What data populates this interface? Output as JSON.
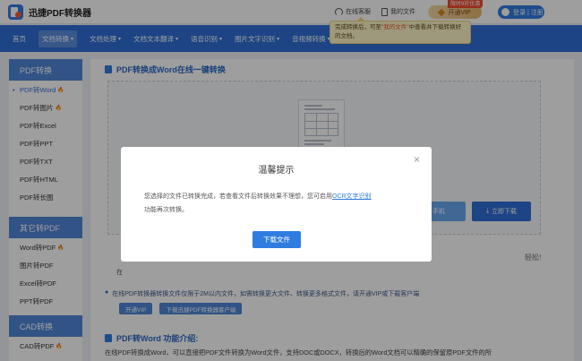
{
  "header": {
    "logo_text": "迅捷PDF转换器",
    "service_label": "在线客服",
    "myfiles_label": "我的文件",
    "vip_label": "开通VIP",
    "vip_badge": "限时9折优惠",
    "login_label": "登录 | 注册"
  },
  "tooltip": {
    "part1": "完成转换后，可至",
    "highlight": "\"我的文件\"",
    "part2": "中查看并下载转换好的文档。"
  },
  "nav": {
    "items": [
      {
        "label": "首页",
        "arrow": ""
      },
      {
        "label": "文档转换",
        "arrow": "▾"
      },
      {
        "label": "文档处理",
        "arrow": "▾"
      },
      {
        "label": "文档文本翻译",
        "arrow": "▾"
      },
      {
        "label": "语音识别",
        "arrow": "▾"
      },
      {
        "label": "图片文字识别",
        "arrow": "▾"
      },
      {
        "label": "音视频转换",
        "arrow": "▾"
      },
      {
        "label": "户端",
        "arrow": "▾"
      }
    ]
  },
  "sidebar": {
    "sections": [
      {
        "title": "PDF转换",
        "items": [
          {
            "label": "PDF转Word",
            "hot": true
          },
          {
            "label": "PDF转图片",
            "hot": true
          },
          {
            "label": "PDF转Excel",
            "hot": false
          },
          {
            "label": "PDF转PPT",
            "hot": false
          },
          {
            "label": "PDF转TXT",
            "hot": false
          },
          {
            "label": "PDF转HTML",
            "hot": false
          },
          {
            "label": "PDF转长图",
            "hot": false
          }
        ]
      },
      {
        "title": "其它转PDF",
        "items": [
          {
            "label": "Word转PDF",
            "hot": true
          },
          {
            "label": "图片转PDF",
            "hot": false
          },
          {
            "label": "Excel转PDF",
            "hot": false
          },
          {
            "label": "PPT转PDF",
            "hot": false
          }
        ]
      },
      {
        "title": "CAD转换",
        "items": [
          {
            "label": "CAD转PDF",
            "hot": true
          }
        ]
      }
    ],
    "fire_glyph": "🔥"
  },
  "main": {
    "title": "PDF转换成Word在线一键转换",
    "phone_btn": "手机",
    "download_btn": "立即下载",
    "download_glyph": "⤓",
    "stray_left": "在",
    "stray_right": "轻松!",
    "notice": "在线PDF转换器转换文件仅限于2M以内文件，如需转换更大文件、转换更多格式文件，请开通VIP或下载客户端",
    "notice_btn_vip": "开通VIP",
    "notice_btn_client": "下载迅捷PDF转换器客户端",
    "intro_title": "PDF转Word 功能介绍:",
    "intro_text": "在线PDF转换成Word，可以直接把PDF文件转换为Word文件，支持DOC或DOCX，转换后的Word文档可以精确的保留原PDF文件的所"
  },
  "modal": {
    "title": "温馨提示",
    "close": "×",
    "text1": "您选择的文件已转换完成，若查看文件后转换效果不理想，您可启用",
    "link": "OCR文字识别",
    "text2": "功能再次转换。",
    "button": "下载文件"
  }
}
